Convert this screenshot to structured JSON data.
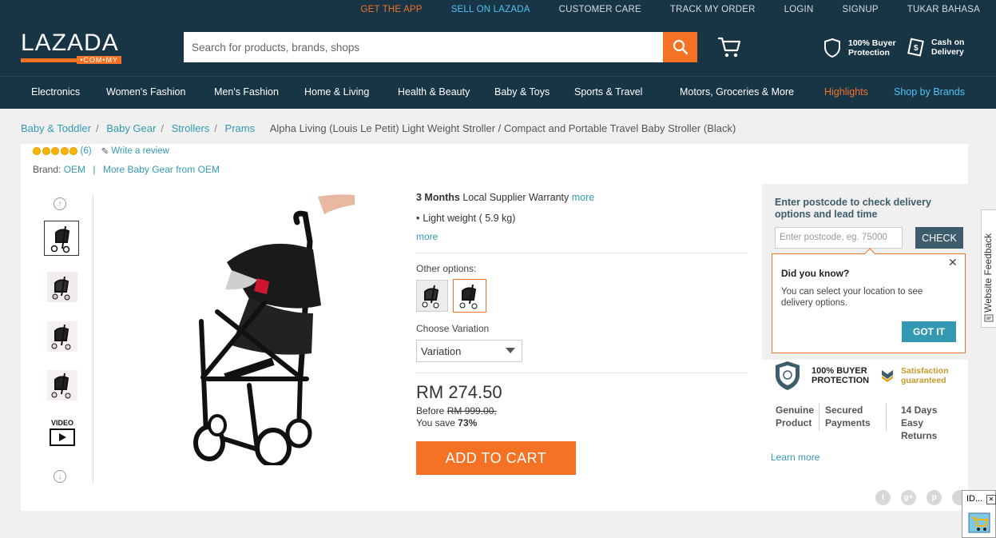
{
  "topbar": {
    "get_app": "GET THE APP",
    "sell": "SELL ON LAZADA",
    "care": "CUSTOMER CARE",
    "track": "TRACK MY ORDER",
    "login": "LOGIN",
    "signup": "SIGNUP",
    "language": "TUKAR BAHASA"
  },
  "logo": {
    "word": "LAZADA",
    "domain": "•COM•MY"
  },
  "search": {
    "placeholder": "Search for products, brands, shops"
  },
  "assurances": {
    "buyer_line1": "100% Buyer",
    "buyer_line2": "Protection",
    "cod_line1": "Cash on",
    "cod_line2": "Delivery"
  },
  "nav": {
    "items": [
      "Electronics",
      "Women's Fashion",
      "Men's Fashion",
      "Home & Living",
      "Health & Beauty",
      "Baby & Toys",
      "Sports & Travel",
      "Motors, Groceries & More"
    ],
    "highlights": "Highlights",
    "brands": "Shop by Brands"
  },
  "breadcrumb": {
    "items": [
      "Baby & Toddler",
      "Baby Gear",
      "Strollers",
      "Prams"
    ],
    "current": "Alpha Living (Louis Le Petit) Light Weight Stroller / Compact and Portable Travel Baby Stroller (Black)"
  },
  "product": {
    "rating_count": "(6)",
    "write_review": "Write a review",
    "brand_label": "Brand:",
    "brand": "OEM",
    "brand_more": "More Baby Gear from OEM",
    "video_label": "VIDEO",
    "warranty_bold": "3 Months",
    "warranty_rest": "Local Supplier Warranty",
    "warranty_more": "more",
    "feature": "Light weight ( 5.9 kg)",
    "feature_more": "more",
    "other_options": "Other options:",
    "choose_variation": "Choose Variation",
    "variation_value": "Variation",
    "price": "RM 274.50",
    "before_label": "Before",
    "before_price": "RM 999.00,",
    "save_label": "You save",
    "save_pct": "73%",
    "add_to_cart": "ADD TO CART"
  },
  "delivery": {
    "title": "Enter postcode to check delivery options and lead time",
    "postcode_placeholder": "Enter postcode, eg. 75000",
    "check": "CHECK"
  },
  "popup": {
    "title": "Did you know?",
    "body": "You can select your location to see delivery options.",
    "button": "GOT IT",
    "close": "✕"
  },
  "protection": {
    "line1": "100% BUYER",
    "line2": "PROTECTION",
    "sat1": "Satisfaction",
    "sat2": "guaranteed",
    "genuine1": "Genuine",
    "genuine2": "Product",
    "secured1": "Secured",
    "secured2": "Payments",
    "days1": "14 Days",
    "days2": "Easy",
    "days3": "Returns",
    "learn_more": "Learn more"
  },
  "feedback": "Website Feedback",
  "mini_window": {
    "title": "ID...",
    "close": "✕"
  },
  "colors": {
    "brand_dark": "#183545",
    "accent": "#f57224",
    "link": "#3399b3"
  }
}
